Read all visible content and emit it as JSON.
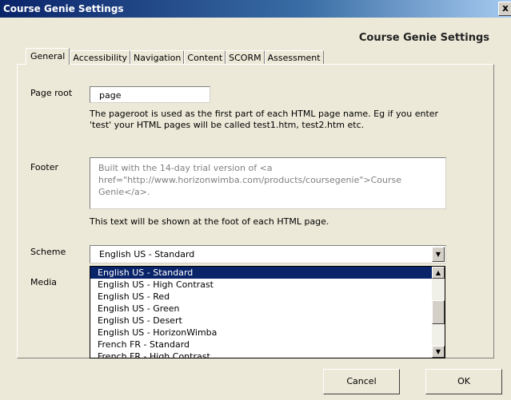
{
  "window": {
    "title": "Course Genie Settings",
    "close_glyph": "x"
  },
  "dialog": {
    "heading": "Course Genie Settings"
  },
  "tabs": [
    "General",
    "Accessibility",
    "Navigation",
    "Content",
    "SCORM",
    "Assessment"
  ],
  "general": {
    "page_root": {
      "label": "Page root",
      "value": "page",
      "help": "The pageroot is used as the first part of each HTML page name. Eg if you enter\n'test' your HTML pages will be called test1.htm, test2.htm etc."
    },
    "footer": {
      "label": "Footer",
      "value": "Built with the 14-day trial version of <a href=\"http://www.horizonwimba.com/products/coursegenie\">Course Genie</a>.",
      "help": "This text will be shown at the foot of each HTML page."
    },
    "scheme": {
      "label": "Scheme",
      "value": "English US - Standard",
      "options": [
        "English US - Standard",
        "English US - High Contrast",
        "English US - Red",
        "English US - Green",
        "English US - Desert",
        "English US - HorizonWimba",
        "French FR - Standard",
        "French FR - High Contrast"
      ],
      "selected_index": 0
    },
    "media": {
      "label": "Media"
    }
  },
  "buttons": {
    "cancel": "Cancel",
    "ok": "OK"
  }
}
